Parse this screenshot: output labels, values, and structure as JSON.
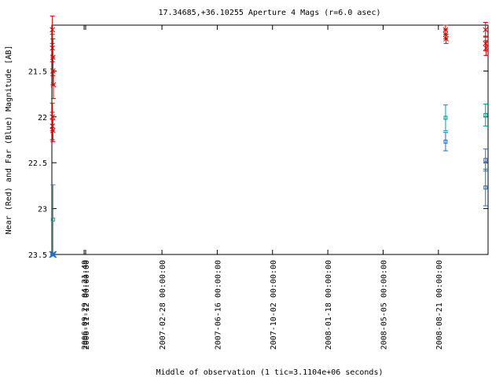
{
  "chart_data": {
    "type": "scatter",
    "title": "17.34685,+36.10255   Aperture 4 Mags (r=6.0 asec)",
    "xlabel": "Middle of observation (1 tic=3.1104e+06 seconds)",
    "ylabel": "Near (Red) and Far (Blue) Magnitude [AB]",
    "ylim": [
      23.5,
      21.0
    ],
    "y_ticks": [
      {
        "value": 21.5,
        "label": "21.5"
      },
      {
        "value": 22,
        "label": "22"
      },
      {
        "value": 22.5,
        "label": "22.5"
      },
      {
        "value": 23,
        "label": "23"
      },
      {
        "value": 23.5,
        "label": "23.5"
      }
    ],
    "xlim": [
      "2006-07-28",
      "2008-11-26"
    ],
    "x_ticks": [
      {
        "date": "2006-09-29",
        "label": "2006-09-29 04:21:49"
      },
      {
        "date": "2006-10-02",
        "label": "2006-11-12 00:00:00"
      },
      {
        "date": "2007-02-28",
        "label": "2007-02-28 00:00:00"
      },
      {
        "date": "2007-06-16",
        "label": "2007-06-16 00:00:00"
      },
      {
        "date": "2007-10-02",
        "label": "2007-10-02 00:00:00"
      },
      {
        "date": "2008-01-18",
        "label": "2008-01-18 00:00:00"
      },
      {
        "date": "2008-05-05",
        "label": "2008-05-05 00:00:00"
      },
      {
        "date": "2008-08-21",
        "label": "2008-08-21 00:00:00"
      }
    ],
    "grid": false,
    "legend": "none",
    "series": [
      {
        "color": "#dd0000",
        "marker": "cross",
        "points": [
          {
            "x": "2006-07-29",
            "y": 21.05,
            "err": 0.15
          },
          {
            "x": "2006-07-29",
            "y": 21.25,
            "err": 0.15
          },
          {
            "x": "2006-07-30",
            "y": 21.35,
            "err": 0.2
          },
          {
            "x": "2006-07-30",
            "y": 21.5,
            "err": 0.15
          },
          {
            "x": "2006-07-31",
            "y": 21.65,
            "err": 0.15
          },
          {
            "x": "2006-07-29",
            "y": 22.0,
            "err": 0.15
          },
          {
            "x": "2006-07-29",
            "y": 22.1,
            "err": 0.15
          },
          {
            "x": "2006-07-30",
            "y": 22.15,
            "err": 0.12
          },
          {
            "x": "2008-09-04",
            "y": 21.05,
            "err": 0.05
          },
          {
            "x": "2008-09-04",
            "y": 21.1,
            "err": 0.05
          },
          {
            "x": "2008-09-05",
            "y": 21.15,
            "err": 0.05
          },
          {
            "x": "2008-11-21",
            "y": 21.05,
            "err": 0.08
          },
          {
            "x": "2008-11-21",
            "y": 21.2,
            "err": 0.08
          },
          {
            "x": "2008-11-22",
            "y": 21.25,
            "err": 0.08
          }
        ]
      },
      {
        "color": "#00a0a0",
        "marker": "square",
        "points": [
          {
            "x": "2006-07-30",
            "y": 23.12,
            "err": 0.38
          },
          {
            "x": "2008-09-04",
            "y": 22.01,
            "err": 0.14
          },
          {
            "x": "2008-11-21",
            "y": 21.98,
            "err": 0.12
          }
        ]
      },
      {
        "color": "#1f6fd0",
        "marker": "square",
        "points": [
          {
            "x": "2006-07-29",
            "y": 23.5,
            "err": 0.0
          },
          {
            "x": "2006-07-30",
            "y": 23.5,
            "err": 0.0
          },
          {
            "x": "2006-07-31",
            "y": 23.5,
            "err": 0.0
          },
          {
            "x": "2008-09-04",
            "y": 22.27,
            "err": 0.1
          },
          {
            "x": "2008-11-21",
            "y": 22.47,
            "err": 0.12
          },
          {
            "x": "2008-11-21",
            "y": 22.77,
            "err": 0.2
          }
        ]
      }
    ]
  }
}
